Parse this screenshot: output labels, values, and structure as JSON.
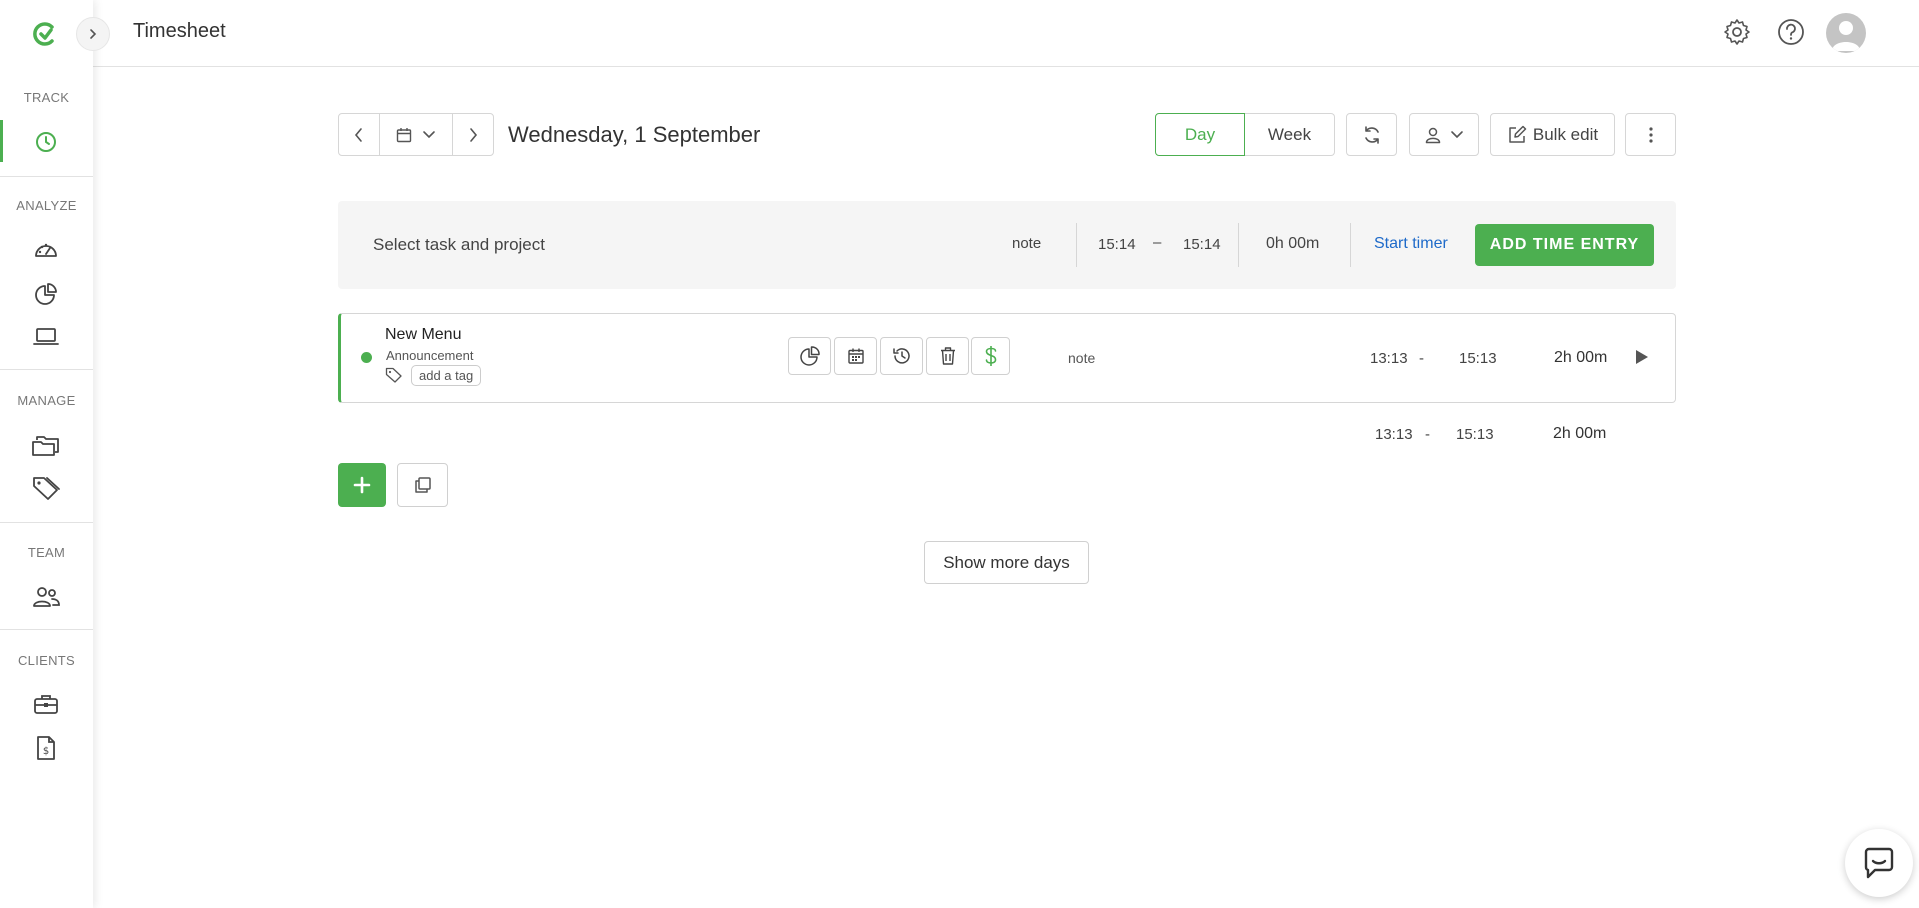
{
  "app": {
    "page_title": "Timesheet"
  },
  "sidebar": {
    "sections": [
      {
        "label": "TRACK"
      },
      {
        "label": "ANALYZE"
      },
      {
        "label": "MANAGE"
      },
      {
        "label": "TEAM"
      },
      {
        "label": "CLIENTS"
      }
    ],
    "items": [
      {
        "icon": "clock-icon",
        "section": "TRACK"
      },
      {
        "icon": "dashboard-icon",
        "section": "ANALYZE"
      },
      {
        "icon": "reports-pie-icon",
        "section": "ANALYZE"
      },
      {
        "icon": "laptop-icon",
        "section": "ANALYZE"
      },
      {
        "icon": "folder-icon",
        "section": "MANAGE"
      },
      {
        "icon": "tags-icon",
        "section": "MANAGE"
      },
      {
        "icon": "people-icon",
        "section": "TEAM"
      },
      {
        "icon": "briefcase-icon",
        "section": "CLIENTS"
      },
      {
        "icon": "invoice-icon",
        "section": "CLIENTS"
      }
    ]
  },
  "date_nav": {
    "date_label": "Wednesday, 1 September"
  },
  "view_toggle": {
    "day_label": "Day",
    "week_label": "Week",
    "selected": "Day"
  },
  "toolbar": {
    "bulk_edit_label": "Bulk edit"
  },
  "timer_bar": {
    "placeholder": "Select task and project",
    "note": "note",
    "start": "15:14",
    "dash": "–",
    "end": "15:14",
    "duration": "0h 00m",
    "start_timer_label": "Start timer",
    "add_entry_label": "ADD TIME ENTRY"
  },
  "entry": {
    "title": "New Menu",
    "project": "Announcement",
    "tag_label": "add a tag",
    "note": "note",
    "start": "13:13",
    "dash": "-",
    "end": "15:13",
    "duration": "2h 00m"
  },
  "summary": {
    "start": "13:13",
    "dash": "-",
    "end": "15:13",
    "duration": "2h 00m"
  },
  "show_more_label": "Show more days",
  "colors": {
    "accent": "#4caf50",
    "link": "#1e6ac9"
  }
}
